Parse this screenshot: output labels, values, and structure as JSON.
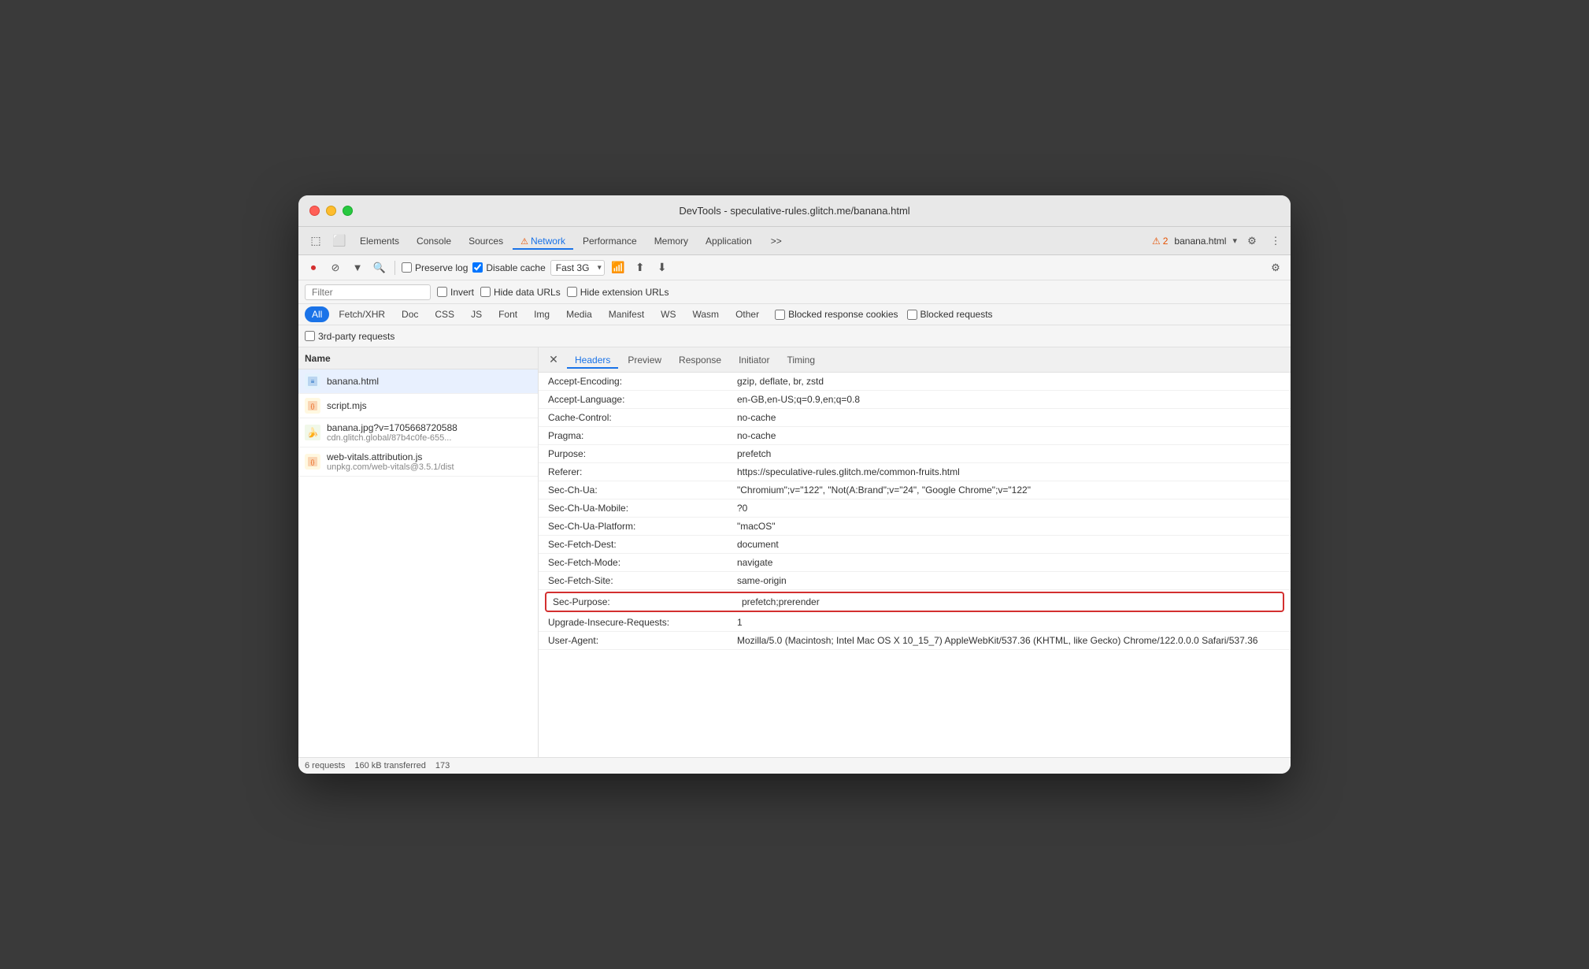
{
  "window": {
    "title": "DevTools - speculative-rules.glitch.me/banana.html"
  },
  "devtools_tabs": {
    "tabs": [
      {
        "id": "elements",
        "label": "Elements",
        "active": false
      },
      {
        "id": "console",
        "label": "Console",
        "active": false
      },
      {
        "id": "sources",
        "label": "Sources",
        "active": false
      },
      {
        "id": "network",
        "label": "Network",
        "active": true,
        "warning": true
      },
      {
        "id": "performance",
        "label": "Performance",
        "active": false
      },
      {
        "id": "memory",
        "label": "Memory",
        "active": false
      },
      {
        "id": "application",
        "label": "Application",
        "active": false
      }
    ],
    "more_label": ">>",
    "warning_count": "2",
    "current_page": "banana.html"
  },
  "toolbar": {
    "throttle_option": "Fast 3G",
    "preserve_log": "Preserve log",
    "disable_cache": "Disable cache"
  },
  "filter": {
    "placeholder": "Filter",
    "invert_label": "Invert",
    "hide_data_urls_label": "Hide data URLs",
    "hide_extension_urls_label": "Hide extension URLs"
  },
  "filter_types": {
    "buttons": [
      {
        "id": "all",
        "label": "All",
        "active": true
      },
      {
        "id": "fetch-xhr",
        "label": "Fetch/XHR",
        "active": false
      },
      {
        "id": "doc",
        "label": "Doc",
        "active": false
      },
      {
        "id": "css",
        "label": "CSS",
        "active": false
      },
      {
        "id": "js",
        "label": "JS",
        "active": false
      },
      {
        "id": "font",
        "label": "Font",
        "active": false
      },
      {
        "id": "img",
        "label": "Img",
        "active": false
      },
      {
        "id": "media",
        "label": "Media",
        "active": false
      },
      {
        "id": "manifest",
        "label": "Manifest",
        "active": false
      },
      {
        "id": "ws",
        "label": "WS",
        "active": false
      },
      {
        "id": "wasm",
        "label": "Wasm",
        "active": false
      },
      {
        "id": "other",
        "label": "Other",
        "active": false
      }
    ],
    "blocked_response_cookies": "Blocked response cookies",
    "blocked_requests": "Blocked requests"
  },
  "third_party": {
    "label": "3rd-party requests"
  },
  "file_list": {
    "header": "Name",
    "files": [
      {
        "id": "banana-html",
        "name": "banana.html",
        "url": "",
        "icon": "html",
        "selected": true
      },
      {
        "id": "script-mjs",
        "name": "script.mjs",
        "url": "",
        "icon": "js",
        "selected": false
      },
      {
        "id": "banana-jpg",
        "name": "banana.jpg?v=1705668720588",
        "url": "cdn.glitch.global/87b4c0fe-655...",
        "icon": "img",
        "selected": false
      },
      {
        "id": "web-vitals-js",
        "name": "web-vitals.attribution.js",
        "url": "unpkg.com/web-vitals@3.5.1/dist",
        "icon": "js",
        "selected": false
      }
    ]
  },
  "detail_tabs": {
    "tabs": [
      {
        "id": "headers",
        "label": "Headers",
        "active": true
      },
      {
        "id": "preview",
        "label": "Preview",
        "active": false
      },
      {
        "id": "response",
        "label": "Response",
        "active": false
      },
      {
        "id": "initiator",
        "label": "Initiator",
        "active": false
      },
      {
        "id": "timing",
        "label": "Timing",
        "active": false
      }
    ]
  },
  "headers": [
    {
      "name": "Accept-Encoding:",
      "value": "gzip, deflate, br, zstd"
    },
    {
      "name": "Accept-Language:",
      "value": "en-GB,en-US;q=0.9,en;q=0.8"
    },
    {
      "name": "Cache-Control:",
      "value": "no-cache"
    },
    {
      "name": "Pragma:",
      "value": "no-cache"
    },
    {
      "name": "Purpose:",
      "value": "prefetch"
    },
    {
      "name": "Referer:",
      "value": "https://speculative-rules.glitch.me/common-fruits.html"
    },
    {
      "name": "Sec-Ch-Ua:",
      "value": "\"Chromium\";v=\"122\", \"Not(A:Brand\";v=\"24\", \"Google Chrome\";v=\"122\""
    },
    {
      "name": "Sec-Ch-Ua-Mobile:",
      "value": "?0"
    },
    {
      "name": "Sec-Ch-Ua-Platform:",
      "value": "\"macOS\""
    },
    {
      "name": "Sec-Fetch-Dest:",
      "value": "document"
    },
    {
      "name": "Sec-Fetch-Mode:",
      "value": "navigate"
    },
    {
      "name": "Sec-Fetch-Site:",
      "value": "same-origin"
    },
    {
      "name": "Sec-Purpose:",
      "value": "prefetch;prerender",
      "highlighted": true
    },
    {
      "name": "Upgrade-Insecure-Requests:",
      "value": "1"
    },
    {
      "name": "User-Agent:",
      "value": "Mozilla/5.0 (Macintosh; Intel Mac OS X 10_15_7) AppleWebKit/537.36 (KHTML, like Gecko) Chrome/122.0.0.0 Safari/537.36"
    }
  ],
  "status_bar": {
    "requests": "6 requests",
    "transferred": "160 kB transferred",
    "size": "173"
  }
}
